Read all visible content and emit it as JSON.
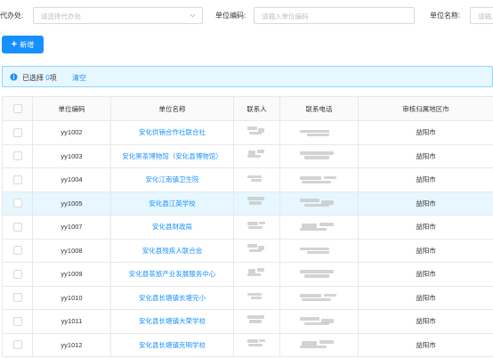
{
  "filters": {
    "agency_label": "代办处:",
    "agency_placeholder": "请选择代办处",
    "unit_code_label": "单位编码:",
    "unit_code_placeholder": "请输入单位编码",
    "unit_name_label": "单位名称:",
    "unit_name_placeholder": "请输入"
  },
  "toolbar": {
    "add_label": "新增"
  },
  "selection": {
    "prefix": "已选择",
    "count": "0",
    "suffix": "项",
    "clear_label": "清空"
  },
  "table": {
    "headers": [
      "单位编码",
      "单位名称",
      "联系人",
      "联系电话",
      "审核归属地区市"
    ],
    "rows": [
      {
        "code": "yy1002",
        "name": "安化供销合作社联合社",
        "region": "益阳市"
      },
      {
        "code": "yy1003",
        "name": "安化黑茶博物馆（安化县博物馆）",
        "region": "益阳市"
      },
      {
        "code": "yy1004",
        "name": "安化江南镇卫生院",
        "region": "益阳市"
      },
      {
        "code": "yy1005",
        "name": "安化县江英学校",
        "region": "益阳市",
        "highlighted": true
      },
      {
        "code": "yy1007",
        "name": "安化县财政局",
        "region": "益阳市"
      },
      {
        "code": "yy1008",
        "name": "安化县残疾人联合会",
        "region": "益阳市"
      },
      {
        "code": "yy1009",
        "name": "安化县茶旅产业发展服务中心",
        "region": "益阳市"
      },
      {
        "code": "yy1010",
        "name": "安化县长塘镇长塘完小",
        "region": "益阳市"
      },
      {
        "code": "yy1011",
        "name": "安化县长塘镇大荣学校",
        "region": "益阳市"
      },
      {
        "code": "yy1012",
        "name": "安化县长塘镇克明学校",
        "region": "益阳市"
      }
    ]
  },
  "colors": {
    "accent": "#1890ff",
    "alert_bg": "#e6f7ff",
    "highlight_row": "#e6f7ff"
  }
}
